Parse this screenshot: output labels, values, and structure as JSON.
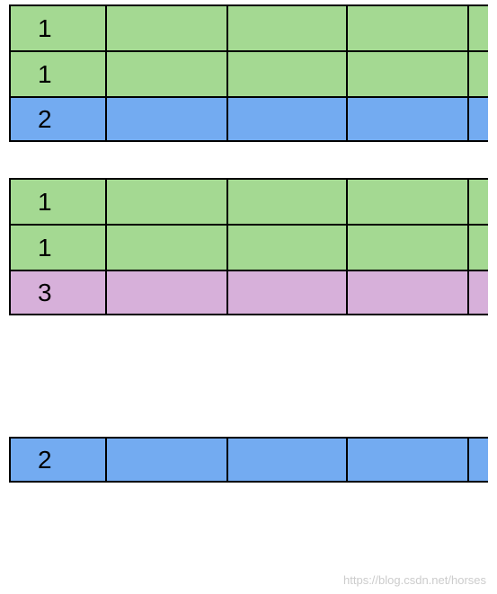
{
  "tables": [
    {
      "rows": [
        {
          "value": "1",
          "color": "green"
        },
        {
          "value": "1",
          "color": "green"
        },
        {
          "value": "2",
          "color": "blue"
        }
      ]
    },
    {
      "rows": [
        {
          "value": "1",
          "color": "green"
        },
        {
          "value": "1",
          "color": "green"
        },
        {
          "value": "3",
          "color": "purple"
        }
      ]
    },
    {
      "rows": [
        {
          "value": "2",
          "color": "blue"
        }
      ]
    }
  ],
  "watermark": "https://blog.csdn.net/horses"
}
